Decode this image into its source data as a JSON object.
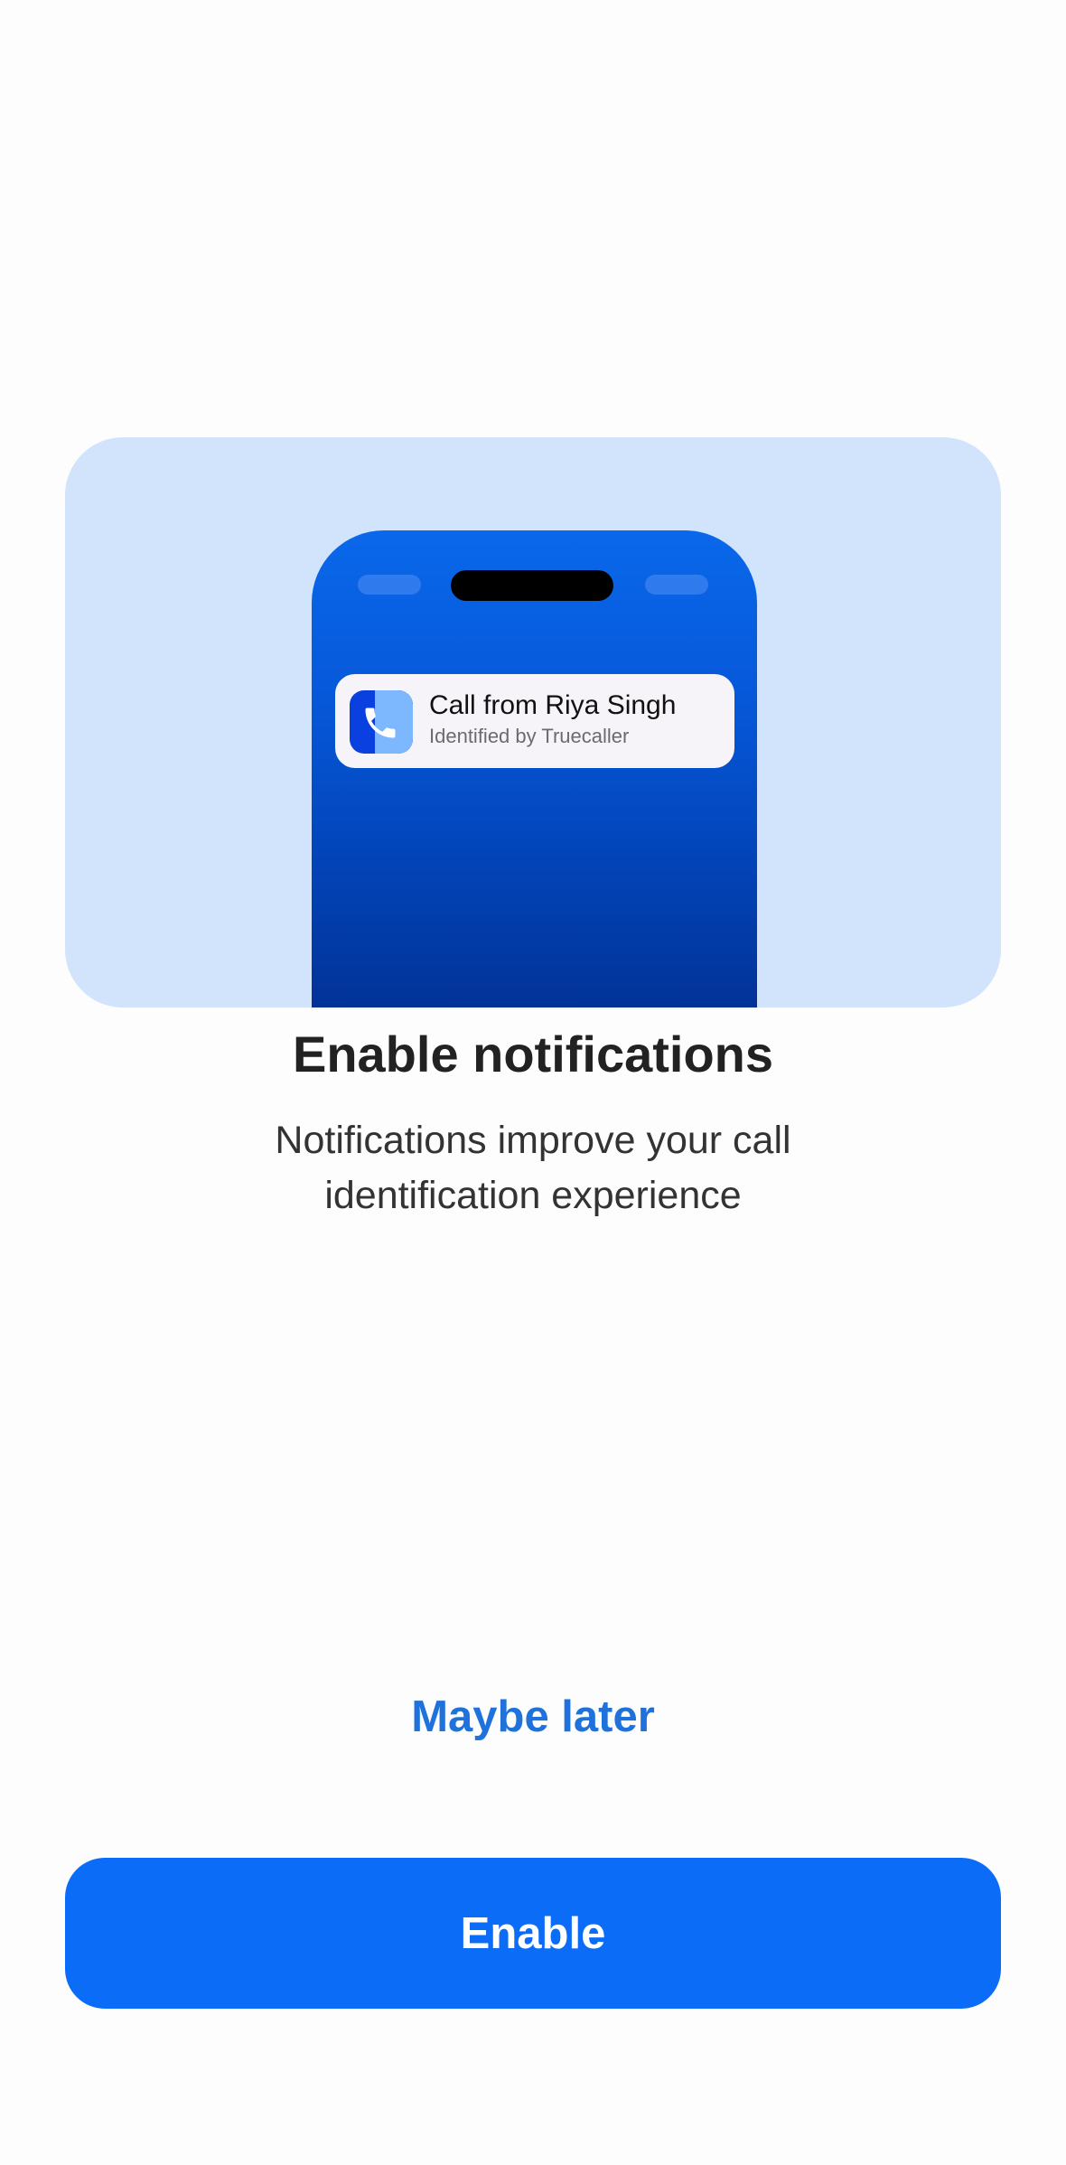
{
  "illustration": {
    "notification": {
      "icon": "truecaller-phone-icon",
      "title": "Call from Riya Singh",
      "subtitle": "Identified by Truecaller"
    }
  },
  "content": {
    "title": "Enable notifications",
    "subtitle": "Notifications improve your call identification experience"
  },
  "actions": {
    "secondary_label": "Maybe later",
    "primary_label": "Enable"
  },
  "colors": {
    "accent": "#0b6cf8",
    "link": "#1f72db",
    "hero_background": "#d1e4fc"
  }
}
